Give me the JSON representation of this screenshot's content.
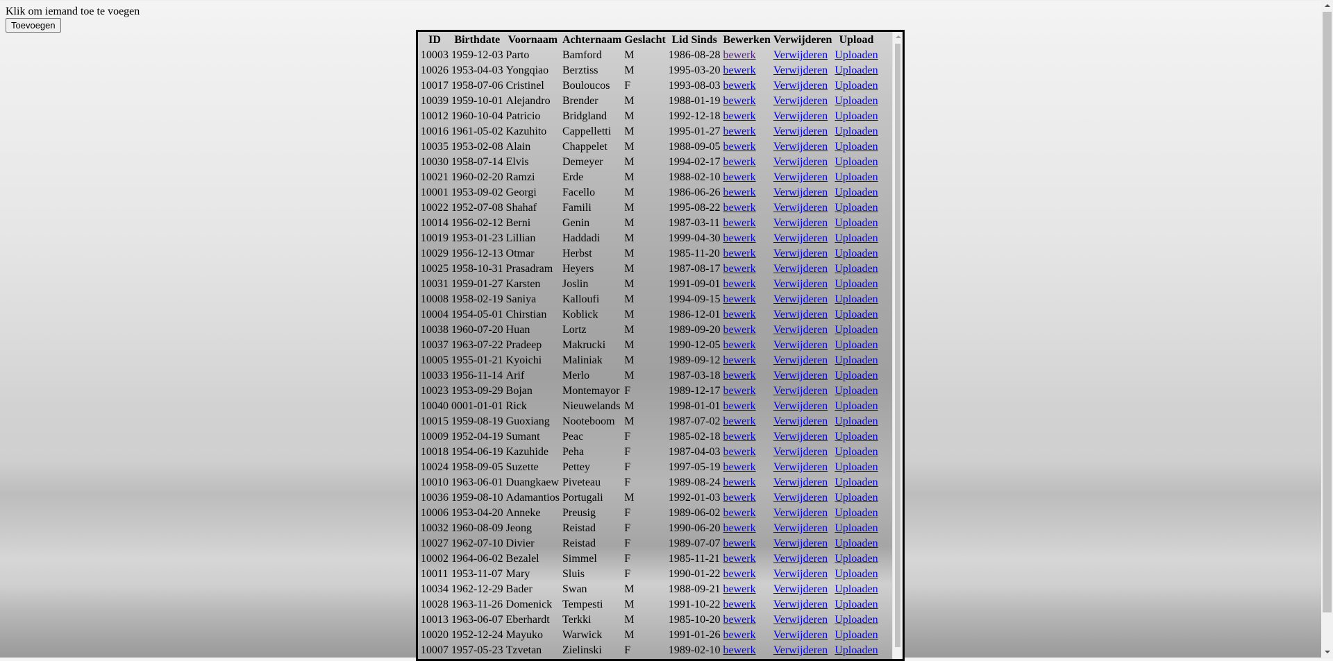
{
  "intro_text": "Klik om iemand toe te voegen",
  "add_button_label": "Toevoegen",
  "columns": [
    "ID",
    "Birthdate",
    "Voornaam",
    "Achternaam",
    "Geslacht",
    "Lid Sinds",
    "Bewerken",
    "Verwijderen",
    "Upload"
  ],
  "action_labels": {
    "edit": "bewerk",
    "delete": "Verwijderen",
    "upload": "Uploaden"
  },
  "colors": {
    "link": "#0000ee",
    "visited_link": "#551a8b",
    "frame_border": "#000000"
  },
  "rows": [
    {
      "id": "10003",
      "birthdate": "1959-12-03",
      "first": "Parto",
      "last": "Bamford",
      "gender": "M",
      "since": "1986-08-28",
      "edit_visited": true
    },
    {
      "id": "10026",
      "birthdate": "1953-04-03",
      "first": "Yongqiao",
      "last": "Berztiss",
      "gender": "M",
      "since": "1995-03-20"
    },
    {
      "id": "10017",
      "birthdate": "1958-07-06",
      "first": "Cristinel",
      "last": "Bouloucos",
      "gender": "F",
      "since": "1993-08-03"
    },
    {
      "id": "10039",
      "birthdate": "1959-10-01",
      "first": "Alejandro",
      "last": "Brender",
      "gender": "M",
      "since": "1988-01-19"
    },
    {
      "id": "10012",
      "birthdate": "1960-10-04",
      "first": "Patricio",
      "last": "Bridgland",
      "gender": "M",
      "since": "1992-12-18"
    },
    {
      "id": "10016",
      "birthdate": "1961-05-02",
      "first": "Kazuhito",
      "last": "Cappelletti",
      "gender": "M",
      "since": "1995-01-27"
    },
    {
      "id": "10035",
      "birthdate": "1953-02-08",
      "first": "Alain",
      "last": "Chappelet",
      "gender": "M",
      "since": "1988-09-05"
    },
    {
      "id": "10030",
      "birthdate": "1958-07-14",
      "first": "Elvis",
      "last": "Demeyer",
      "gender": "M",
      "since": "1994-02-17"
    },
    {
      "id": "10021",
      "birthdate": "1960-02-20",
      "first": "Ramzi",
      "last": "Erde",
      "gender": "M",
      "since": "1988-02-10"
    },
    {
      "id": "10001",
      "birthdate": "1953-09-02",
      "first": "Georgi",
      "last": "Facello",
      "gender": "M",
      "since": "1986-06-26"
    },
    {
      "id": "10022",
      "birthdate": "1952-07-08",
      "first": "Shahaf",
      "last": "Famili",
      "gender": "M",
      "since": "1995-08-22"
    },
    {
      "id": "10014",
      "birthdate": "1956-02-12",
      "first": "Berni",
      "last": "Genin",
      "gender": "M",
      "since": "1987-03-11"
    },
    {
      "id": "10019",
      "birthdate": "1953-01-23",
      "first": "Lillian",
      "last": "Haddadi",
      "gender": "M",
      "since": "1999-04-30"
    },
    {
      "id": "10029",
      "birthdate": "1956-12-13",
      "first": "Otmar",
      "last": "Herbst",
      "gender": "M",
      "since": "1985-11-20"
    },
    {
      "id": "10025",
      "birthdate": "1958-10-31",
      "first": "Prasadram",
      "last": "Heyers",
      "gender": "M",
      "since": "1987-08-17"
    },
    {
      "id": "10031",
      "birthdate": "1959-01-27",
      "first": "Karsten",
      "last": "Joslin",
      "gender": "M",
      "since": "1991-09-01"
    },
    {
      "id": "10008",
      "birthdate": "1958-02-19",
      "first": "Saniya",
      "last": "Kalloufi",
      "gender": "M",
      "since": "1994-09-15"
    },
    {
      "id": "10004",
      "birthdate": "1954-05-01",
      "first": "Chirstian",
      "last": "Koblick",
      "gender": "M",
      "since": "1986-12-01"
    },
    {
      "id": "10038",
      "birthdate": "1960-07-20",
      "first": "Huan",
      "last": "Lortz",
      "gender": "M",
      "since": "1989-09-20"
    },
    {
      "id": "10037",
      "birthdate": "1963-07-22",
      "first": "Pradeep",
      "last": "Makrucki",
      "gender": "M",
      "since": "1990-12-05"
    },
    {
      "id": "10005",
      "birthdate": "1955-01-21",
      "first": "Kyoichi",
      "last": "Maliniak",
      "gender": "M",
      "since": "1989-09-12"
    },
    {
      "id": "10033",
      "birthdate": "1956-11-14",
      "first": "Arif",
      "last": "Merlo",
      "gender": "M",
      "since": "1987-03-18"
    },
    {
      "id": "10023",
      "birthdate": "1953-09-29",
      "first": "Bojan",
      "last": "Montemayor",
      "gender": "F",
      "since": "1989-12-17"
    },
    {
      "id": "10040",
      "birthdate": "0001-01-01",
      "first": "Rick",
      "last": "Nieuwelands",
      "gender": "M",
      "since": "1998-01-01"
    },
    {
      "id": "10015",
      "birthdate": "1959-08-19",
      "first": "Guoxiang",
      "last": "Nooteboom",
      "gender": "M",
      "since": "1987-07-02"
    },
    {
      "id": "10009",
      "birthdate": "1952-04-19",
      "first": "Sumant",
      "last": "Peac",
      "gender": "F",
      "since": "1985-02-18"
    },
    {
      "id": "10018",
      "birthdate": "1954-06-19",
      "first": "Kazuhide",
      "last": "Peha",
      "gender": "F",
      "since": "1987-04-03"
    },
    {
      "id": "10024",
      "birthdate": "1958-09-05",
      "first": "Suzette",
      "last": "Pettey",
      "gender": "F",
      "since": "1997-05-19"
    },
    {
      "id": "10010",
      "birthdate": "1963-06-01",
      "first": "Duangkaew",
      "last": "Piveteau",
      "gender": "F",
      "since": "1989-08-24"
    },
    {
      "id": "10036",
      "birthdate": "1959-08-10",
      "first": "Adamantios",
      "last": "Portugali",
      "gender": "M",
      "since": "1992-01-03"
    },
    {
      "id": "10006",
      "birthdate": "1953-04-20",
      "first": "Anneke",
      "last": "Preusig",
      "gender": "F",
      "since": "1989-06-02"
    },
    {
      "id": "10032",
      "birthdate": "1960-08-09",
      "first": "Jeong",
      "last": "Reistad",
      "gender": "F",
      "since": "1990-06-20"
    },
    {
      "id": "10027",
      "birthdate": "1962-07-10",
      "first": "Divier",
      "last": "Reistad",
      "gender": "F",
      "since": "1989-07-07"
    },
    {
      "id": "10002",
      "birthdate": "1964-06-02",
      "first": "Bezalel",
      "last": "Simmel",
      "gender": "F",
      "since": "1985-11-21"
    },
    {
      "id": "10011",
      "birthdate": "1953-11-07",
      "first": "Mary",
      "last": "Sluis",
      "gender": "F",
      "since": "1990-01-22"
    },
    {
      "id": "10034",
      "birthdate": "1962-12-29",
      "first": "Bader",
      "last": "Swan",
      "gender": "M",
      "since": "1988-09-21"
    },
    {
      "id": "10028",
      "birthdate": "1963-11-26",
      "first": "Domenick",
      "last": "Tempesti",
      "gender": "M",
      "since": "1991-10-22"
    },
    {
      "id": "10013",
      "birthdate": "1963-06-07",
      "first": "Eberhardt",
      "last": "Terkki",
      "gender": "M",
      "since": "1985-10-20"
    },
    {
      "id": "10020",
      "birthdate": "1952-12-24",
      "first": "Mayuko",
      "last": "Warwick",
      "gender": "M",
      "since": "1991-01-26"
    },
    {
      "id": "10007",
      "birthdate": "1957-05-23",
      "first": "Tzvetan",
      "last": "Zielinski",
      "gender": "F",
      "since": "1989-02-10"
    }
  ]
}
